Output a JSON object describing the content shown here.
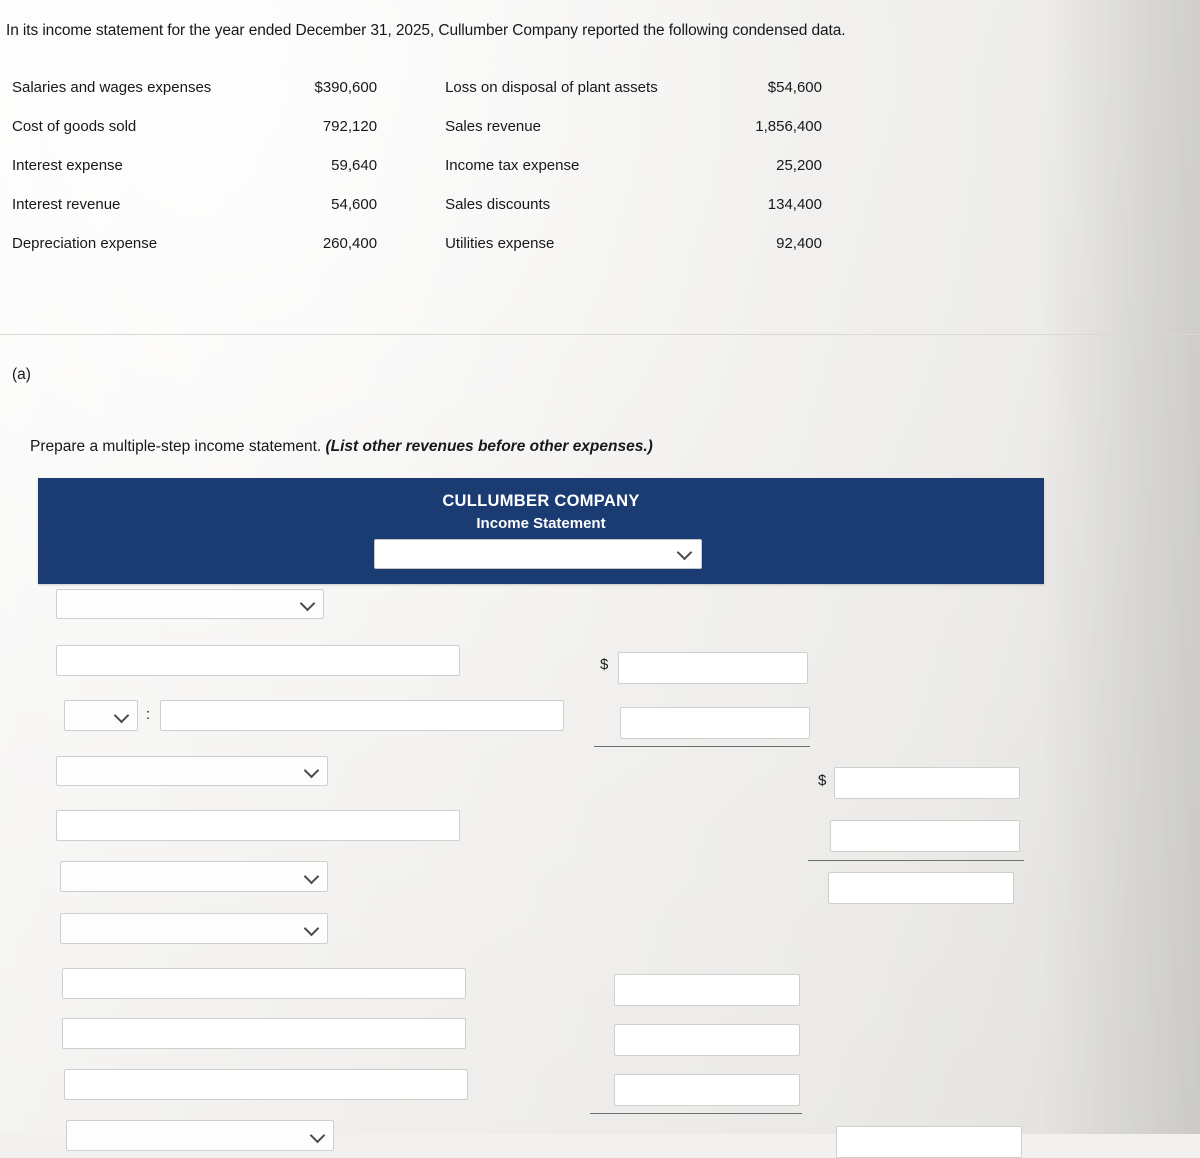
{
  "problem": {
    "intro": "In its income statement for the year ended December 31, 2025, Cullumber Company reported the following condensed data.",
    "rows": [
      {
        "label1": "Salaries and wages expenses",
        "value1": "$390,600",
        "label2": "Loss on disposal of plant assets",
        "value2": "$54,600"
      },
      {
        "label1": "Cost of goods sold",
        "value1": "792,120",
        "label2": "Sales revenue",
        "value2": "1,856,400"
      },
      {
        "label1": "Interest expense",
        "value1": "59,640",
        "label2": "Income tax expense",
        "value2": "25,200"
      },
      {
        "label1": "Interest revenue",
        "value1": "54,600",
        "label2": "Sales discounts",
        "value2": "134,400"
      },
      {
        "label1": "Depreciation expense",
        "value1": "260,400",
        "label2": "Utilities expense",
        "value2": "92,400"
      }
    ]
  },
  "part": {
    "label": "(a)",
    "instruction_plain": "Prepare a multiple-step income statement. ",
    "instruction_italic": "(List other revenues before other expenses.)"
  },
  "statement": {
    "company": "CULLUMBER COMPANY",
    "title": "Income Statement",
    "period_select_value": "",
    "period_select_icon": "chevron-down-icon"
  },
  "form": {
    "dollar_sign": "$",
    "colon": ":",
    "select_icon": "chevron-down-icon",
    "fields": [
      {
        "name": "line-1-account-select",
        "value": ""
      },
      {
        "name": "line-2-account-text",
        "value": ""
      },
      {
        "name": "line-3-account-select",
        "value": ""
      },
      {
        "name": "line-3-account-text",
        "value": ""
      },
      {
        "name": "line-4-account-select",
        "value": ""
      },
      {
        "name": "line-5-account-text",
        "value": ""
      },
      {
        "name": "line-6-account-select",
        "value": ""
      },
      {
        "name": "line-7-account-select",
        "value": ""
      },
      {
        "name": "line-8-account-text",
        "value": ""
      },
      {
        "name": "line-9-account-text",
        "value": ""
      },
      {
        "name": "line-10-account-text",
        "value": ""
      },
      {
        "name": "line-11-account-select",
        "value": ""
      },
      {
        "name": "amount-col1-row1",
        "value": ""
      },
      {
        "name": "amount-col1-row2",
        "value": ""
      },
      {
        "name": "amount-col1-row3",
        "value": ""
      },
      {
        "name": "amount-col1-row4",
        "value": ""
      },
      {
        "name": "amount-col1-row5",
        "value": ""
      },
      {
        "name": "amount-col2-row1",
        "value": ""
      },
      {
        "name": "amount-col2-row2",
        "value": ""
      },
      {
        "name": "amount-col2-row3",
        "value": ""
      },
      {
        "name": "amount-col2-row4",
        "value": ""
      }
    ]
  }
}
